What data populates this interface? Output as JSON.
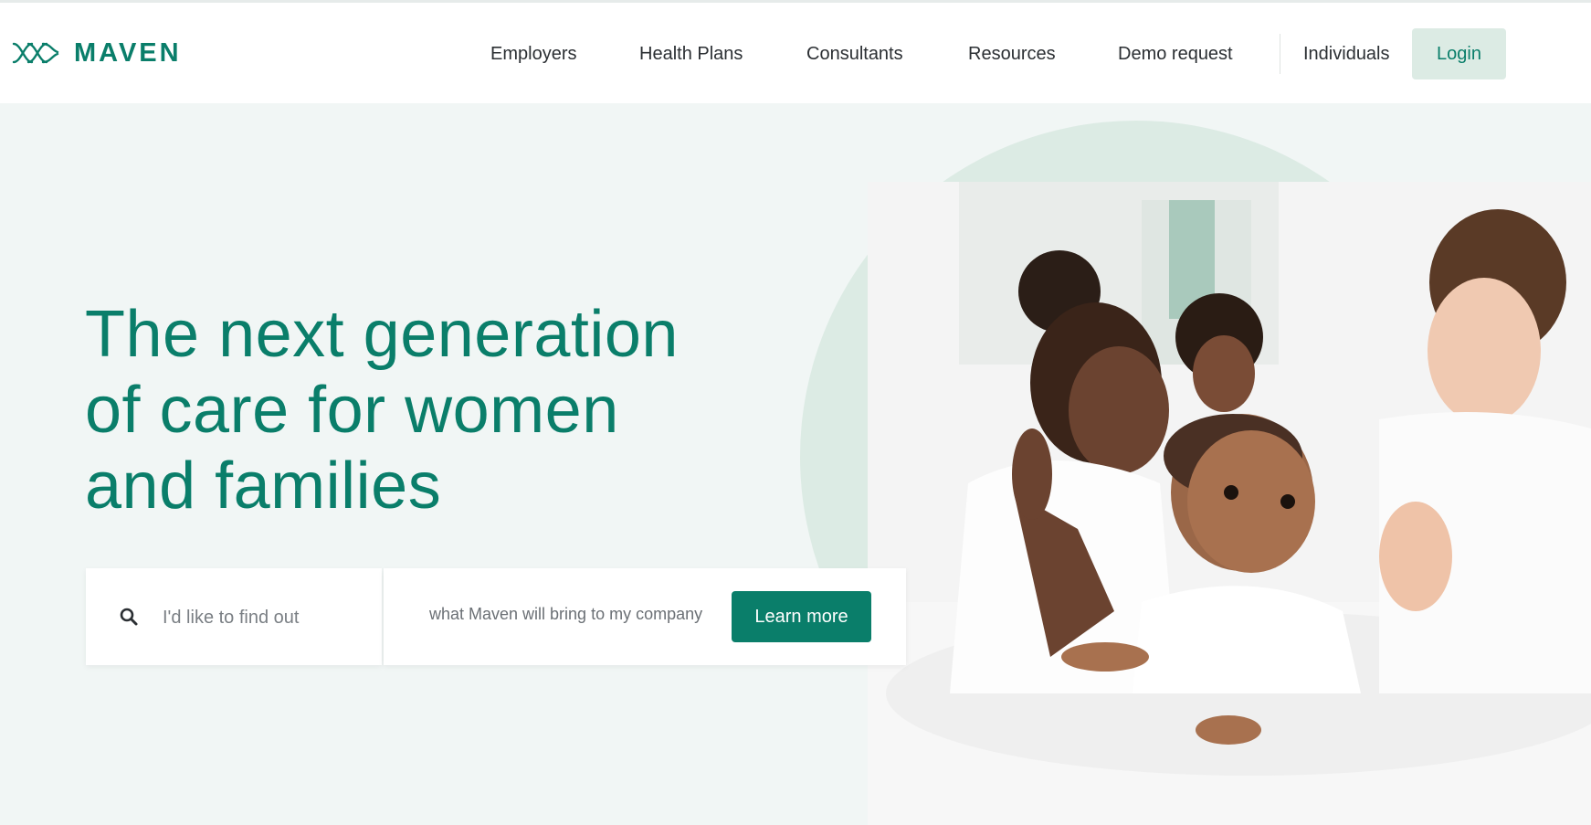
{
  "brand": {
    "name": "MAVEN",
    "color": "#0a7e6a",
    "logo_icon": "maven-wave-icon"
  },
  "nav": {
    "items": [
      {
        "label": "Employers"
      },
      {
        "label": "Health Plans"
      },
      {
        "label": "Consultants"
      },
      {
        "label": "Resources"
      },
      {
        "label": "Demo request"
      },
      {
        "label": "Individuals"
      }
    ],
    "login_label": "Login"
  },
  "hero": {
    "headline_lines": [
      "The next generation",
      "of care for women",
      "and families"
    ],
    "search_placeholder": "I'd like to find out",
    "search_icon": "search-icon",
    "selected_option": "what Maven will bring to my company",
    "cta_label": "Learn more",
    "photo_icon": "family-photo"
  },
  "colors": {
    "accent": "#0a7e6a",
    "hero_bg": "#f1f6f5",
    "circle": "#dcebe4",
    "login_bg": "#dcebe4"
  }
}
